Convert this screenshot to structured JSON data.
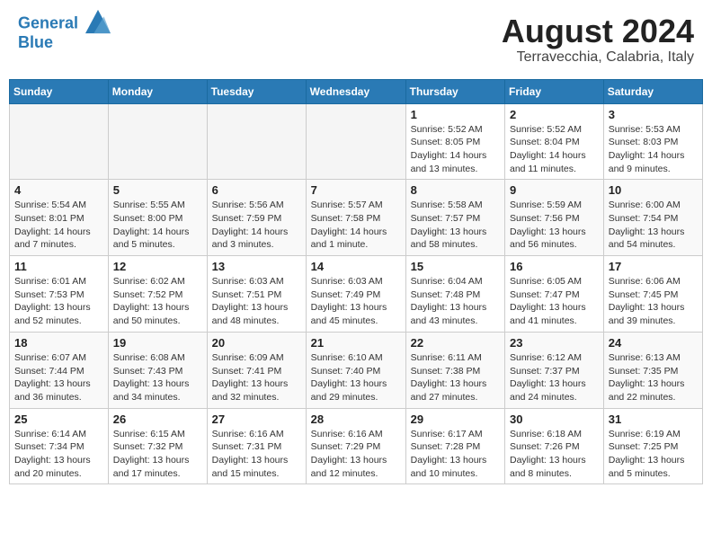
{
  "header": {
    "logo_line1": "General",
    "logo_line2": "Blue",
    "month_year": "August 2024",
    "location": "Terravecchia, Calabria, Italy"
  },
  "weekdays": [
    "Sunday",
    "Monday",
    "Tuesday",
    "Wednesday",
    "Thursday",
    "Friday",
    "Saturday"
  ],
  "weeks": [
    [
      {
        "day": "",
        "sunrise": "",
        "sunset": "",
        "daylight": ""
      },
      {
        "day": "",
        "sunrise": "",
        "sunset": "",
        "daylight": ""
      },
      {
        "day": "",
        "sunrise": "",
        "sunset": "",
        "daylight": ""
      },
      {
        "day": "",
        "sunrise": "",
        "sunset": "",
        "daylight": ""
      },
      {
        "day": "1",
        "sunrise": "Sunrise: 5:52 AM",
        "sunset": "Sunset: 8:05 PM",
        "daylight": "Daylight: 14 hours and 13 minutes."
      },
      {
        "day": "2",
        "sunrise": "Sunrise: 5:52 AM",
        "sunset": "Sunset: 8:04 PM",
        "daylight": "Daylight: 14 hours and 11 minutes."
      },
      {
        "day": "3",
        "sunrise": "Sunrise: 5:53 AM",
        "sunset": "Sunset: 8:03 PM",
        "daylight": "Daylight: 14 hours and 9 minutes."
      }
    ],
    [
      {
        "day": "4",
        "sunrise": "Sunrise: 5:54 AM",
        "sunset": "Sunset: 8:01 PM",
        "daylight": "Daylight: 14 hours and 7 minutes."
      },
      {
        "day": "5",
        "sunrise": "Sunrise: 5:55 AM",
        "sunset": "Sunset: 8:00 PM",
        "daylight": "Daylight: 14 hours and 5 minutes."
      },
      {
        "day": "6",
        "sunrise": "Sunrise: 5:56 AM",
        "sunset": "Sunset: 7:59 PM",
        "daylight": "Daylight: 14 hours and 3 minutes."
      },
      {
        "day": "7",
        "sunrise": "Sunrise: 5:57 AM",
        "sunset": "Sunset: 7:58 PM",
        "daylight": "Daylight: 14 hours and 1 minute."
      },
      {
        "day": "8",
        "sunrise": "Sunrise: 5:58 AM",
        "sunset": "Sunset: 7:57 PM",
        "daylight": "Daylight: 13 hours and 58 minutes."
      },
      {
        "day": "9",
        "sunrise": "Sunrise: 5:59 AM",
        "sunset": "Sunset: 7:56 PM",
        "daylight": "Daylight: 13 hours and 56 minutes."
      },
      {
        "day": "10",
        "sunrise": "Sunrise: 6:00 AM",
        "sunset": "Sunset: 7:54 PM",
        "daylight": "Daylight: 13 hours and 54 minutes."
      }
    ],
    [
      {
        "day": "11",
        "sunrise": "Sunrise: 6:01 AM",
        "sunset": "Sunset: 7:53 PM",
        "daylight": "Daylight: 13 hours and 52 minutes."
      },
      {
        "day": "12",
        "sunrise": "Sunrise: 6:02 AM",
        "sunset": "Sunset: 7:52 PM",
        "daylight": "Daylight: 13 hours and 50 minutes."
      },
      {
        "day": "13",
        "sunrise": "Sunrise: 6:03 AM",
        "sunset": "Sunset: 7:51 PM",
        "daylight": "Daylight: 13 hours and 48 minutes."
      },
      {
        "day": "14",
        "sunrise": "Sunrise: 6:03 AM",
        "sunset": "Sunset: 7:49 PM",
        "daylight": "Daylight: 13 hours and 45 minutes."
      },
      {
        "day": "15",
        "sunrise": "Sunrise: 6:04 AM",
        "sunset": "Sunset: 7:48 PM",
        "daylight": "Daylight: 13 hours and 43 minutes."
      },
      {
        "day": "16",
        "sunrise": "Sunrise: 6:05 AM",
        "sunset": "Sunset: 7:47 PM",
        "daylight": "Daylight: 13 hours and 41 minutes."
      },
      {
        "day": "17",
        "sunrise": "Sunrise: 6:06 AM",
        "sunset": "Sunset: 7:45 PM",
        "daylight": "Daylight: 13 hours and 39 minutes."
      }
    ],
    [
      {
        "day": "18",
        "sunrise": "Sunrise: 6:07 AM",
        "sunset": "Sunset: 7:44 PM",
        "daylight": "Daylight: 13 hours and 36 minutes."
      },
      {
        "day": "19",
        "sunrise": "Sunrise: 6:08 AM",
        "sunset": "Sunset: 7:43 PM",
        "daylight": "Daylight: 13 hours and 34 minutes."
      },
      {
        "day": "20",
        "sunrise": "Sunrise: 6:09 AM",
        "sunset": "Sunset: 7:41 PM",
        "daylight": "Daylight: 13 hours and 32 minutes."
      },
      {
        "day": "21",
        "sunrise": "Sunrise: 6:10 AM",
        "sunset": "Sunset: 7:40 PM",
        "daylight": "Daylight: 13 hours and 29 minutes."
      },
      {
        "day": "22",
        "sunrise": "Sunrise: 6:11 AM",
        "sunset": "Sunset: 7:38 PM",
        "daylight": "Daylight: 13 hours and 27 minutes."
      },
      {
        "day": "23",
        "sunrise": "Sunrise: 6:12 AM",
        "sunset": "Sunset: 7:37 PM",
        "daylight": "Daylight: 13 hours and 24 minutes."
      },
      {
        "day": "24",
        "sunrise": "Sunrise: 6:13 AM",
        "sunset": "Sunset: 7:35 PM",
        "daylight": "Daylight: 13 hours and 22 minutes."
      }
    ],
    [
      {
        "day": "25",
        "sunrise": "Sunrise: 6:14 AM",
        "sunset": "Sunset: 7:34 PM",
        "daylight": "Daylight: 13 hours and 20 minutes."
      },
      {
        "day": "26",
        "sunrise": "Sunrise: 6:15 AM",
        "sunset": "Sunset: 7:32 PM",
        "daylight": "Daylight: 13 hours and 17 minutes."
      },
      {
        "day": "27",
        "sunrise": "Sunrise: 6:16 AM",
        "sunset": "Sunset: 7:31 PM",
        "daylight": "Daylight: 13 hours and 15 minutes."
      },
      {
        "day": "28",
        "sunrise": "Sunrise: 6:16 AM",
        "sunset": "Sunset: 7:29 PM",
        "daylight": "Daylight: 13 hours and 12 minutes."
      },
      {
        "day": "29",
        "sunrise": "Sunrise: 6:17 AM",
        "sunset": "Sunset: 7:28 PM",
        "daylight": "Daylight: 13 hours and 10 minutes."
      },
      {
        "day": "30",
        "sunrise": "Sunrise: 6:18 AM",
        "sunset": "Sunset: 7:26 PM",
        "daylight": "Daylight: 13 hours and 8 minutes."
      },
      {
        "day": "31",
        "sunrise": "Sunrise: 6:19 AM",
        "sunset": "Sunset: 7:25 PM",
        "daylight": "Daylight: 13 hours and 5 minutes."
      }
    ]
  ]
}
